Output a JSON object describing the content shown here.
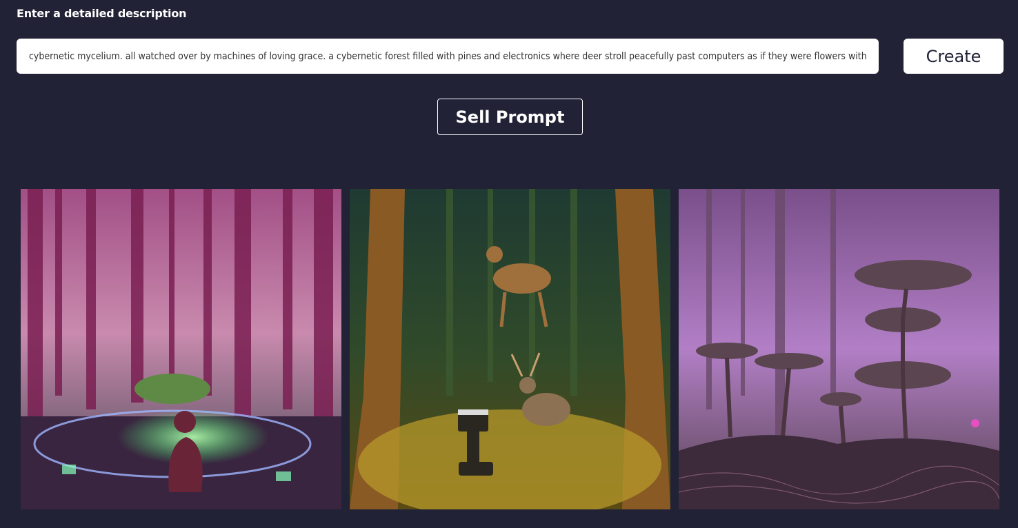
{
  "form": {
    "label": "Enter a detailed description",
    "prompt_value": "cybernetic mycelium. all watched over by machines of loving grace. a cybernetic forest filled with pines and electronics where deer stroll peacefully past computers as if they were flowers with spinning blossoms",
    "create_label": "Create",
    "sell_label": "Sell Prompt"
  },
  "gallery": {
    "images": [
      {
        "theme": "magenta-forest-glowing-machine-circle",
        "accent": "#b0376f"
      },
      {
        "theme": "golden-forest-deer-robot",
        "accent": "#c8a030"
      },
      {
        "theme": "purple-forest-mushroom-trees",
        "accent": "#a56bd0"
      }
    ]
  }
}
